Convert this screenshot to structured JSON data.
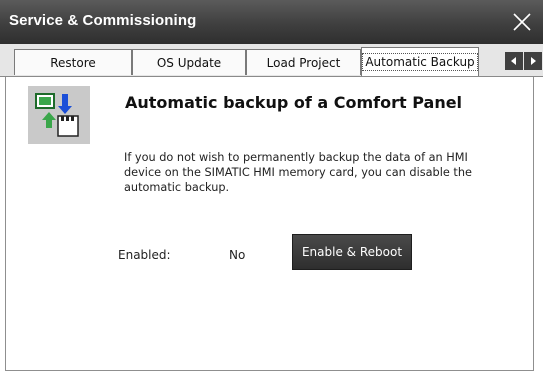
{
  "window": {
    "title": "Service & Commissioning",
    "close_icon": "close-icon"
  },
  "tabs": [
    {
      "label": "Restore"
    },
    {
      "label": "OS Update"
    },
    {
      "label": "Load Project"
    },
    {
      "label": "Automatic Backup",
      "active": true
    }
  ],
  "tab_scroll": {
    "left_icon": "chevron-left-icon",
    "right_icon": "chevron-right-icon"
  },
  "page": {
    "icon": "backup-icon",
    "heading": "Automatic backup of a Comfort Panel",
    "description": "If you do not wish to permanently backup the data of an HMI device on the SIMATIC HMI memory card, you can disable the automatic backup.",
    "status_label": "Enabled:",
    "status_value": "No",
    "action_button": "Enable & Reboot"
  },
  "colors": {
    "titlebar": "#3f3f3f",
    "button": "#3a3a3a",
    "icon_green": "#3aa64a",
    "icon_blue": "#1b4fd8"
  }
}
